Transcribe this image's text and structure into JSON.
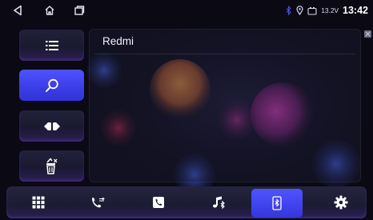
{
  "status_bar": {
    "icons": [
      "back-icon",
      "home-icon",
      "recent-apps-icon",
      "bluetooth-icon",
      "location-icon",
      "battery-icon"
    ],
    "voltage": "13.2V",
    "time": "13:42"
  },
  "sidebar": {
    "items": [
      {
        "name": "device-list",
        "icon": "list-icon"
      },
      {
        "name": "search-devices",
        "icon": "search-icon",
        "active": true
      },
      {
        "name": "connect",
        "icon": "plug-icon"
      },
      {
        "name": "delete-pairing",
        "icon": "trash-icon"
      }
    ]
  },
  "device_panel": {
    "device_name": "Redmi"
  },
  "dock": {
    "items": [
      {
        "name": "dialpad",
        "icon": "dialpad-icon"
      },
      {
        "name": "call-log",
        "icon": "call-log-icon"
      },
      {
        "name": "contacts",
        "icon": "contacts-icon"
      },
      {
        "name": "bt-music",
        "icon": "bluetooth-music-icon"
      },
      {
        "name": "bt-device",
        "icon": "bluetooth-phone-icon",
        "active": true
      },
      {
        "name": "settings",
        "icon": "settings-gear-icon"
      }
    ]
  },
  "colors": {
    "accent": "#4a50f5",
    "background": "#0a0914",
    "orb_orange": "#e0853e",
    "orb_magenta": "#c43ba8",
    "orb_blue": "#3551c8"
  }
}
